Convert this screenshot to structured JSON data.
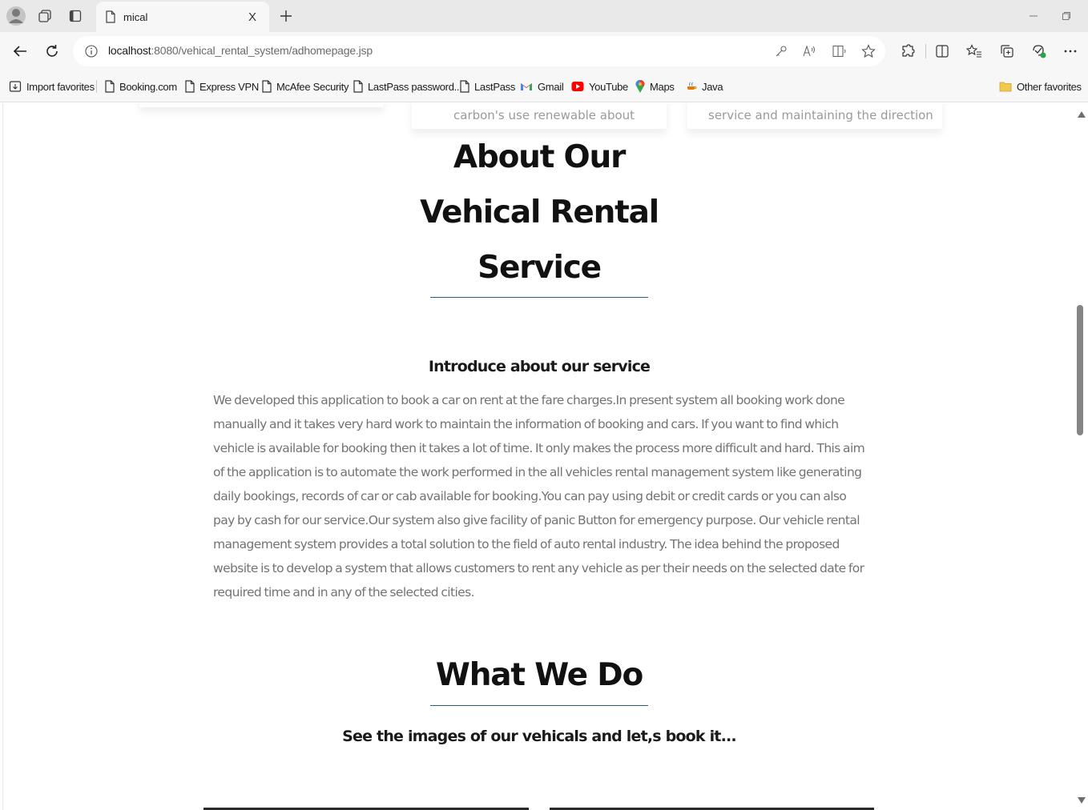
{
  "browser": {
    "tab": {
      "title": "mical",
      "close_label": "X"
    },
    "address_bar": {
      "url_host": "localhost",
      "url_path": ":8080/vehical_rental_system/adhomepage.jsp"
    },
    "favorites": [
      {
        "label": "Import favorites",
        "icon": "import-icon"
      },
      {
        "label": "Booking.com",
        "icon": "page-icon"
      },
      {
        "label": "Express VPN",
        "icon": "page-icon"
      },
      {
        "label": "McAfee Security",
        "icon": "page-icon"
      },
      {
        "label": "LastPass password...",
        "icon": "page-icon"
      },
      {
        "label": "LastPass",
        "icon": "page-icon"
      },
      {
        "label": "Gmail",
        "icon": "gmail-icon"
      },
      {
        "label": "YouTube",
        "icon": "youtube-icon"
      },
      {
        "label": "Maps",
        "icon": "maps-icon"
      },
      {
        "label": "Java",
        "icon": "java-icon"
      }
    ],
    "other_favorites": "Other favorites"
  },
  "page": {
    "cards_cutoff": {
      "card2_text": "carbon's use renewable about",
      "card3_text": "service and maintaining the direction"
    },
    "about": {
      "title_line1": "About Our",
      "title_line2": "Vehical Rental",
      "title_line3": "Service",
      "intro_heading": "Introduce about our service",
      "intro_body": "We developed this application to book a car on rent at the fare charges.In present system all booking work done manually and it takes very hard work to maintain the information of booking and cars. If you want to find which vehicle is available for booking then it takes a lot of time. It only makes the process more difficult and hard. This aim of the application is to automate the work performed in the all vehicles rental management system like generating daily bookings, records of car or cab available for booking.You can pay using debit or credit cards or you can also pay by cash for our service.Our system also give facility of panic Button for emergency purpose. Our vehicle rental management system provides a total solution to the field of auto rental industry. The idea behind the proposed website is to develop a system that allows customers to rent any vehicle as per their needs on the selected date for required time and in any of the selected cities."
    },
    "what_we_do": {
      "title": "What We Do",
      "subtitle": "See the images of our vehicals and let,s book it..."
    }
  },
  "colors": {
    "accent_rule": "#2d5c88",
    "body_text": "#737373",
    "heading_text": "#111111"
  }
}
